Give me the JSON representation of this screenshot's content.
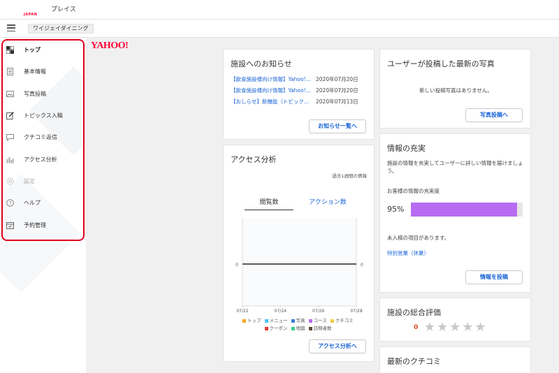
{
  "header": {
    "logo_text": "YAHOO!",
    "logo_sub": "JAPAN",
    "logo_suffix": "プレイス",
    "shop_name": "ワイジェイダイニング"
  },
  "sidebar": {
    "items": [
      {
        "label": "トップ",
        "icon": "dashboard-icon",
        "state": "active"
      },
      {
        "label": "基本情報",
        "icon": "document-icon",
        "state": "normal"
      },
      {
        "label": "写真投稿",
        "icon": "photo-icon",
        "state": "normal"
      },
      {
        "label": "トピックス入稿",
        "icon": "edit-icon",
        "state": "normal"
      },
      {
        "label": "クチコミ返信",
        "icon": "chat-icon",
        "state": "normal"
      },
      {
        "label": "アクセス分析",
        "icon": "bar-chart-icon",
        "state": "normal"
      },
      {
        "label": "設定",
        "icon": "gear-icon",
        "state": "disabled"
      },
      {
        "label": "ヘルプ",
        "icon": "help-icon",
        "state": "normal"
      },
      {
        "label": "予約管理",
        "icon": "calendar-icon",
        "state": "normal"
      }
    ],
    "highlight_color": "#e0001b"
  },
  "notices": {
    "title": "施設へのお知らせ",
    "items": [
      {
        "text": "【飲食施設様向け情報】Yahoo!...",
        "date": "2020年07月20日"
      },
      {
        "text": "【飲食施設様向け情報】Yahoo!...",
        "date": "2020年07月20日"
      },
      {
        "text": "【おしらせ】新機能（トピック...",
        "date": "2020年07月13日"
      }
    ],
    "button": "お知らせ一覧へ"
  },
  "access": {
    "title": "アクセス分析",
    "period_note": "過去1週間の情報",
    "tabs": [
      "閲覧数",
      "アクション数"
    ],
    "button": "アクセス分析へ"
  },
  "chart_data": {
    "type": "line",
    "x": [
      "07/22",
      "07/24",
      "07/26",
      "07/28"
    ],
    "series": [
      {
        "name": "トップ",
        "color": "#f5a623",
        "values": [
          0,
          0,
          0,
          0
        ]
      },
      {
        "name": "メニュー",
        "color": "#4fc3f7",
        "values": [
          0,
          0,
          0,
          0
        ]
      },
      {
        "name": "写真",
        "color": "#3b7dd8",
        "values": [
          0,
          0,
          0,
          0
        ]
      },
      {
        "name": "コース",
        "color": "#b76cf2",
        "values": [
          0,
          0,
          0,
          0
        ]
      },
      {
        "name": "クチコミ",
        "color": "#f7c948",
        "values": [
          0,
          0,
          0,
          0
        ]
      },
      {
        "name": "クーポン",
        "color": "#e53935",
        "values": [
          0,
          0,
          0,
          0
        ]
      },
      {
        "name": "地図",
        "color": "#3ecf8e",
        "values": [
          0,
          0,
          0,
          0
        ]
      },
      {
        "name": "訪問者数",
        "color": "#5a4a3a",
        "values": [
          0,
          0,
          0,
          0
        ]
      }
    ],
    "y_left_label": "0",
    "y_right_label": "0",
    "ylim": [
      0,
      0
    ]
  },
  "photos": {
    "title": "ユーザーが投稿した最新の写真",
    "empty_text": "新しい投稿写真はありません。",
    "button": "写真投稿へ"
  },
  "completeness": {
    "title": "情報の充実",
    "description": "施設の情報を充実してユーザーに詳しい情報を届けましょう。",
    "label": "お客様の情報の充実度",
    "percent_text": "95%",
    "percent": 95,
    "missing_note": "未入稿の項目があります。",
    "missing_link": "特別営業（休業）",
    "button": "情報を投稿",
    "bar_color": "#b76cf2"
  },
  "rating": {
    "title": "施設の総合評価",
    "score": "0",
    "stars": 5,
    "filled": 0
  },
  "reviews": {
    "title": "最新のクチコミ"
  }
}
